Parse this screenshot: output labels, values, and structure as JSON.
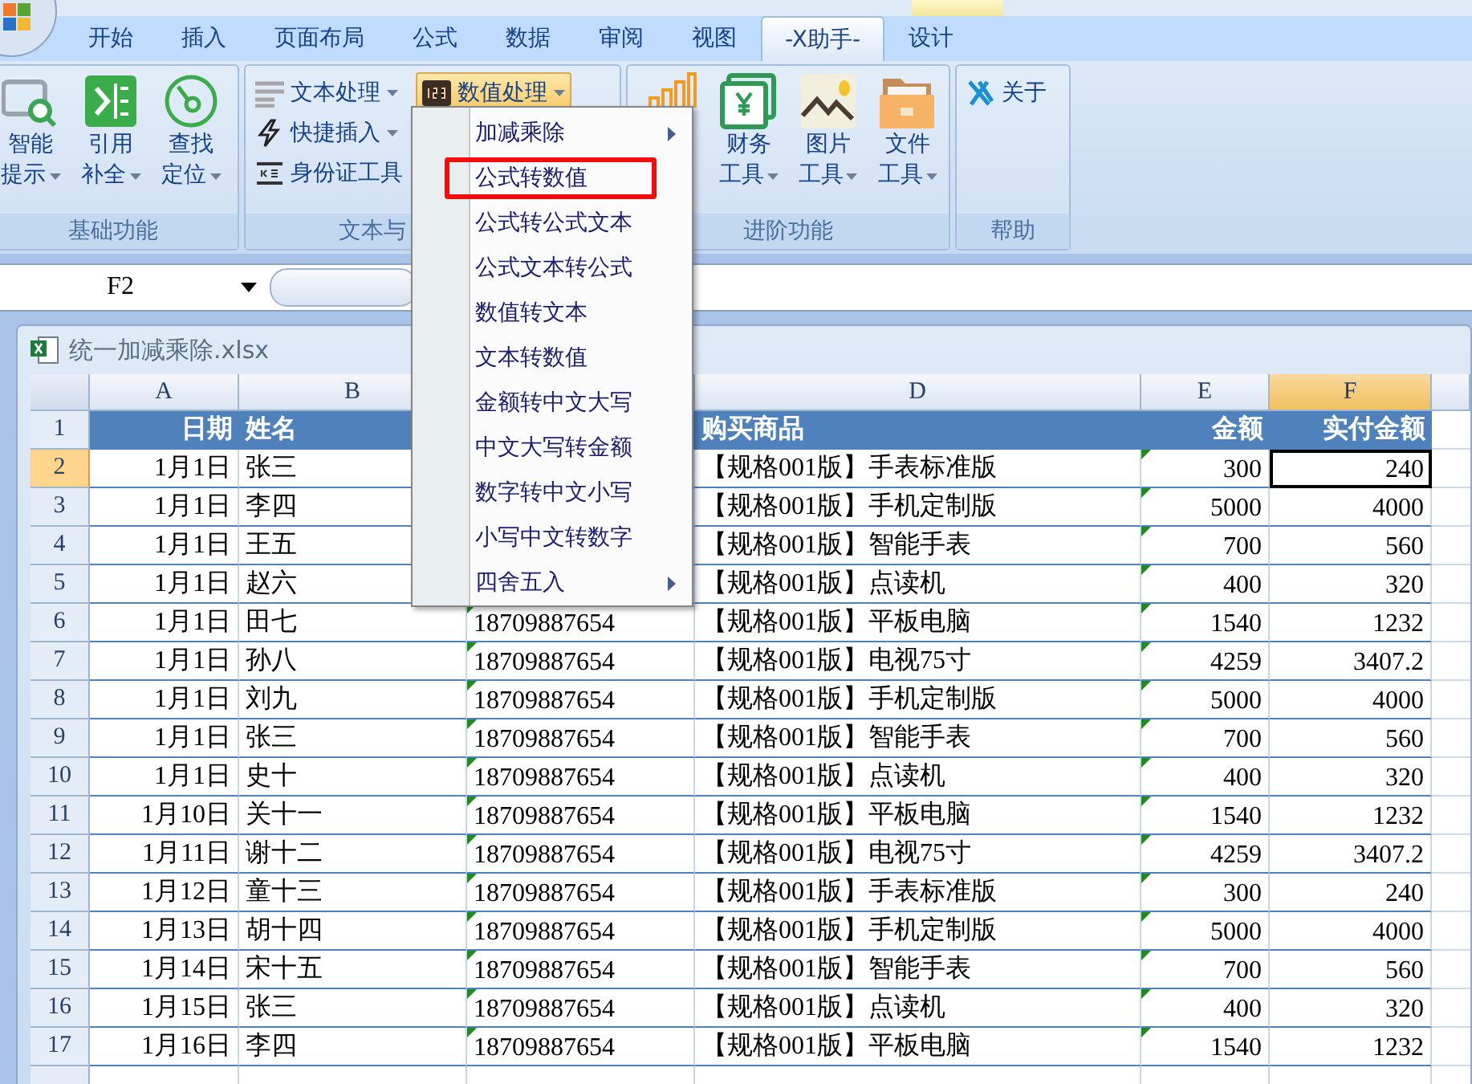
{
  "tabs": [
    {
      "label": "开始",
      "selected": false
    },
    {
      "label": "插入",
      "selected": false
    },
    {
      "label": "页面布局",
      "selected": false
    },
    {
      "label": "公式",
      "selected": false
    },
    {
      "label": "数据",
      "selected": false
    },
    {
      "label": "审阅",
      "selected": false
    },
    {
      "label": "视图",
      "selected": false
    },
    {
      "label": "-X助手-",
      "selected": true
    },
    {
      "label": "设计",
      "selected": false
    }
  ],
  "ribbon": {
    "groups": [
      {
        "label": "基础功能",
        "buttons": [
          {
            "kind": "large",
            "lines": [
              "智能",
              "提示"
            ],
            "dropdown": true
          },
          {
            "kind": "large",
            "lines": [
              "引用",
              "补全"
            ],
            "dropdown": true
          },
          {
            "kind": "large",
            "lines": [
              "查找",
              "定位"
            ],
            "dropdown": true
          }
        ]
      },
      {
        "label": "文本与",
        "buttons": [
          {
            "kind": "small",
            "label": "文本处理",
            "dropdown": true,
            "pressed": false
          },
          {
            "kind": "small",
            "label": "快捷插入",
            "dropdown": true,
            "pressed": false
          },
          {
            "kind": "small",
            "label": "身份证工具",
            "dropdown": false,
            "pressed": false
          },
          {
            "kind": "small",
            "label": "数值处理",
            "dropdown": true,
            "pressed": true
          }
        ]
      },
      {
        "label": "进阶功能",
        "buttons": [
          {
            "kind": "large"
          },
          {
            "kind": "large",
            "lines": [
              "财务",
              "工具"
            ],
            "dropdown": true
          },
          {
            "kind": "large",
            "lines": [
              "图片",
              "工具"
            ],
            "dropdown": true
          },
          {
            "kind": "large",
            "lines": [
              "文件",
              "工具"
            ],
            "dropdown": true
          }
        ]
      },
      {
        "label": "帮助",
        "buttons": [
          {
            "kind": "small",
            "label": "关于",
            "dropdown": false,
            "pressed": false
          }
        ]
      }
    ]
  },
  "menu": {
    "items": [
      {
        "label": "加减乘除",
        "submenu": true,
        "outlined": false
      },
      {
        "label": "公式转数值",
        "submenu": false,
        "outlined": true
      },
      {
        "label": "公式转公式文本",
        "submenu": false,
        "outlined": false
      },
      {
        "label": "公式文本转公式",
        "submenu": false,
        "outlined": false
      },
      {
        "label": "数值转文本",
        "submenu": false,
        "outlined": false
      },
      {
        "label": "文本转数值",
        "submenu": false,
        "outlined": false
      },
      {
        "label": "金额转中文大写",
        "submenu": false,
        "outlined": false
      },
      {
        "label": "中文大写转金额",
        "submenu": false,
        "outlined": false
      },
      {
        "label": "数字转中文小写",
        "submenu": false,
        "outlined": false
      },
      {
        "label": "小写中文转数字",
        "submenu": false,
        "outlined": false
      },
      {
        "label": "四舍五入",
        "submenu": true,
        "outlined": false
      }
    ]
  },
  "formula_bar": {
    "name_box": "F2"
  },
  "workbook": {
    "title": "统一加减乘除.xlsx"
  },
  "sheet": {
    "columns": [
      {
        "letter": "A",
        "selected": false,
        "flagged": false
      },
      {
        "letter": "B",
        "selected": false,
        "flagged": false
      },
      {
        "selected": false,
        "flagged": true
      },
      {
        "letter": "D",
        "selected": false,
        "flagged": false
      },
      {
        "letter": "E",
        "selected": false,
        "flagged": true
      },
      {
        "letter": "F",
        "selected": true,
        "flagged": false
      }
    ],
    "rows": [
      {
        "number": "1",
        "header": true,
        "selected": false,
        "cells": [
          "日期",
          "姓名",
          null,
          "购买商品",
          "金额",
          "实付金额"
        ]
      },
      {
        "number": "2",
        "header": false,
        "selected": true,
        "cells": [
          "1月1日",
          "张三",
          null,
          "【规格001版】手表标准版",
          "300",
          "240"
        ]
      },
      {
        "number": "3",
        "header": false,
        "selected": false,
        "cells": [
          "1月1日",
          "李四",
          null,
          "【规格001版】手机定制版",
          "5000",
          "4000"
        ]
      },
      {
        "number": "4",
        "header": false,
        "selected": false,
        "cells": [
          "1月1日",
          "王五",
          null,
          "【规格001版】智能手表",
          "700",
          "560"
        ]
      },
      {
        "number": "5",
        "header": false,
        "selected": false,
        "cells": [
          "1月1日",
          "赵六",
          null,
          "【规格001版】点读机",
          "400",
          "320"
        ]
      },
      {
        "number": "6",
        "header": false,
        "selected": false,
        "cells": [
          "1月1日",
          "田七",
          "18709887654",
          "【规格001版】平板电脑",
          "1540",
          "1232"
        ]
      },
      {
        "number": "7",
        "header": false,
        "selected": false,
        "cells": [
          "1月1日",
          "孙八",
          "18709887654",
          "【规格001版】电视75寸",
          "4259",
          "3407.2"
        ]
      },
      {
        "number": "8",
        "header": false,
        "selected": false,
        "cells": [
          "1月1日",
          "刘九",
          "18709887654",
          "【规格001版】手机定制版",
          "5000",
          "4000"
        ]
      },
      {
        "number": "9",
        "header": false,
        "selected": false,
        "cells": [
          "1月1日",
          "张三",
          "18709887654",
          "【规格001版】智能手表",
          "700",
          "560"
        ]
      },
      {
        "number": "10",
        "header": false,
        "selected": false,
        "cells": [
          "1月1日",
          "史十",
          "18709887654",
          "【规格001版】点读机",
          "400",
          "320"
        ]
      },
      {
        "number": "11",
        "header": false,
        "selected": false,
        "cells": [
          "1月10日",
          "关十一",
          "18709887654",
          "【规格001版】平板电脑",
          "1540",
          "1232"
        ]
      },
      {
        "number": "12",
        "header": false,
        "selected": false,
        "cells": [
          "1月11日",
          "谢十二",
          "18709887654",
          "【规格001版】电视75寸",
          "4259",
          "3407.2"
        ]
      },
      {
        "number": "13",
        "header": false,
        "selected": false,
        "cells": [
          "1月12日",
          "童十三",
          "18709887654",
          "【规格001版】手表标准版",
          "300",
          "240"
        ]
      },
      {
        "number": "14",
        "header": false,
        "selected": false,
        "cells": [
          "1月13日",
          "胡十四",
          "18709887654",
          "【规格001版】手机定制版",
          "5000",
          "4000"
        ]
      },
      {
        "number": "15",
        "header": false,
        "selected": false,
        "cells": [
          "1月14日",
          "宋十五",
          "18709887654",
          "【规格001版】智能手表",
          "700",
          "560"
        ]
      },
      {
        "number": "16",
        "header": false,
        "selected": false,
        "cells": [
          "1月15日",
          "张三",
          "18709887654",
          "【规格001版】点读机",
          "400",
          "320"
        ]
      },
      {
        "number": "17",
        "header": false,
        "selected": false,
        "cells": [
          "1月16日",
          "李四",
          "18709887654",
          "【规格001版】平板电脑",
          "1540",
          "1232"
        ]
      }
    ]
  }
}
